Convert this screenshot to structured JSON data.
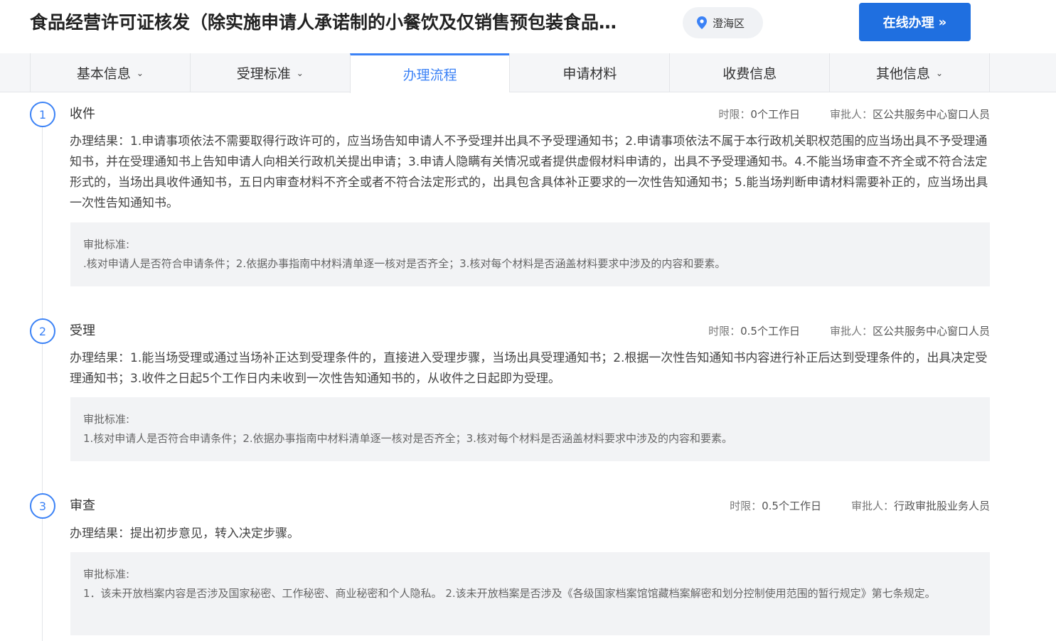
{
  "header": {
    "title": "食品经营许可证核发（除实施申请人承诺制的小餐饮及仅销售预包装食品…",
    "region": "澄海区",
    "online_button": "在线办理",
    "online_chevron": "»"
  },
  "tabs": [
    {
      "label": "基本信息",
      "caret": "⌄"
    },
    {
      "label": "受理标准",
      "caret": "⌄"
    },
    {
      "label": "办理流程"
    },
    {
      "label": "申请材料"
    },
    {
      "label": "收费信息"
    },
    {
      "label": "其他信息",
      "caret": "⌄"
    }
  ],
  "steps": [
    {
      "num": "1",
      "name": "收件",
      "time_label": "时限：",
      "time_value": "0个工作日",
      "approver_label": "审批人：",
      "approver_value": "区公共服务中心窗口人员",
      "result": "办理结果：1.申请事项依法不需要取得行政许可的，应当场告知申请人不予受理并出具不予受理通知书；2.申请事项依法不属于本行政机关职权范围的应当场出具不予受理通知书，并在受理通知书上告知申请人向相关行政机关提出申请；3.申请人隐瞒有关情况或者提供虚假材料申请的，出具不予受理通知书。4.不能当场审查不齐全或不符合法定形式的，当场出具收件通知书，五日内审查材料不齐全或者不符合法定形式的，出具包含具体补正要求的一次性告知通知书；5.能当场判断申请材料需要补正的，应当场出具一次性告知通知书。",
      "criteria_label": "审批标准:",
      "criteria_text": ".核对申请人是否符合申请条件；2.依据办事指南中材料清单逐一核对是否齐全；3.核对每个材料是否涵盖材料要求中涉及的内容和要素。"
    },
    {
      "num": "2",
      "name": "受理",
      "time_label": "时限：",
      "time_value": "0.5个工作日",
      "approver_label": "审批人：",
      "approver_value": "区公共服务中心窗口人员",
      "result": "办理结果：1.能当场受理或通过当场补正达到受理条件的，直接进入受理步骤，当场出具受理通知书；2.根据一次性告知通知书内容进行补正后达到受理条件的，出具决定受理通知书；3.收件之日起5个工作日内未收到一次性告知通知书的，从收件之日起即为受理。",
      "criteria_label": "审批标准:",
      "criteria_text": "1.核对申请人是否符合申请条件；2.依据办事指南中材料清单逐一核对是否齐全；3.核对每个材料是否涵盖材料要求中涉及的内容和要素。"
    },
    {
      "num": "3",
      "name": "审查",
      "time_label": "时限：",
      "time_value": "0.5个工作日",
      "approver_label": "审批人：",
      "approver_value": "行政审批股业务人员",
      "result": "办理结果：提出初步意见，转入决定步骤。",
      "criteria_label": "审批标准:",
      "criteria_text": "1．该未开放档案内容是否涉及国家秘密、工作秘密、商业秘密和个人隐私。 2.该未开放档案是否涉及《各级国家档案馆馆藏档案解密和划分控制使用范围的暂行规定》第七条规定。"
    }
  ],
  "colors": {
    "accent": "#3b82f6",
    "button": "#1f6fe0"
  }
}
